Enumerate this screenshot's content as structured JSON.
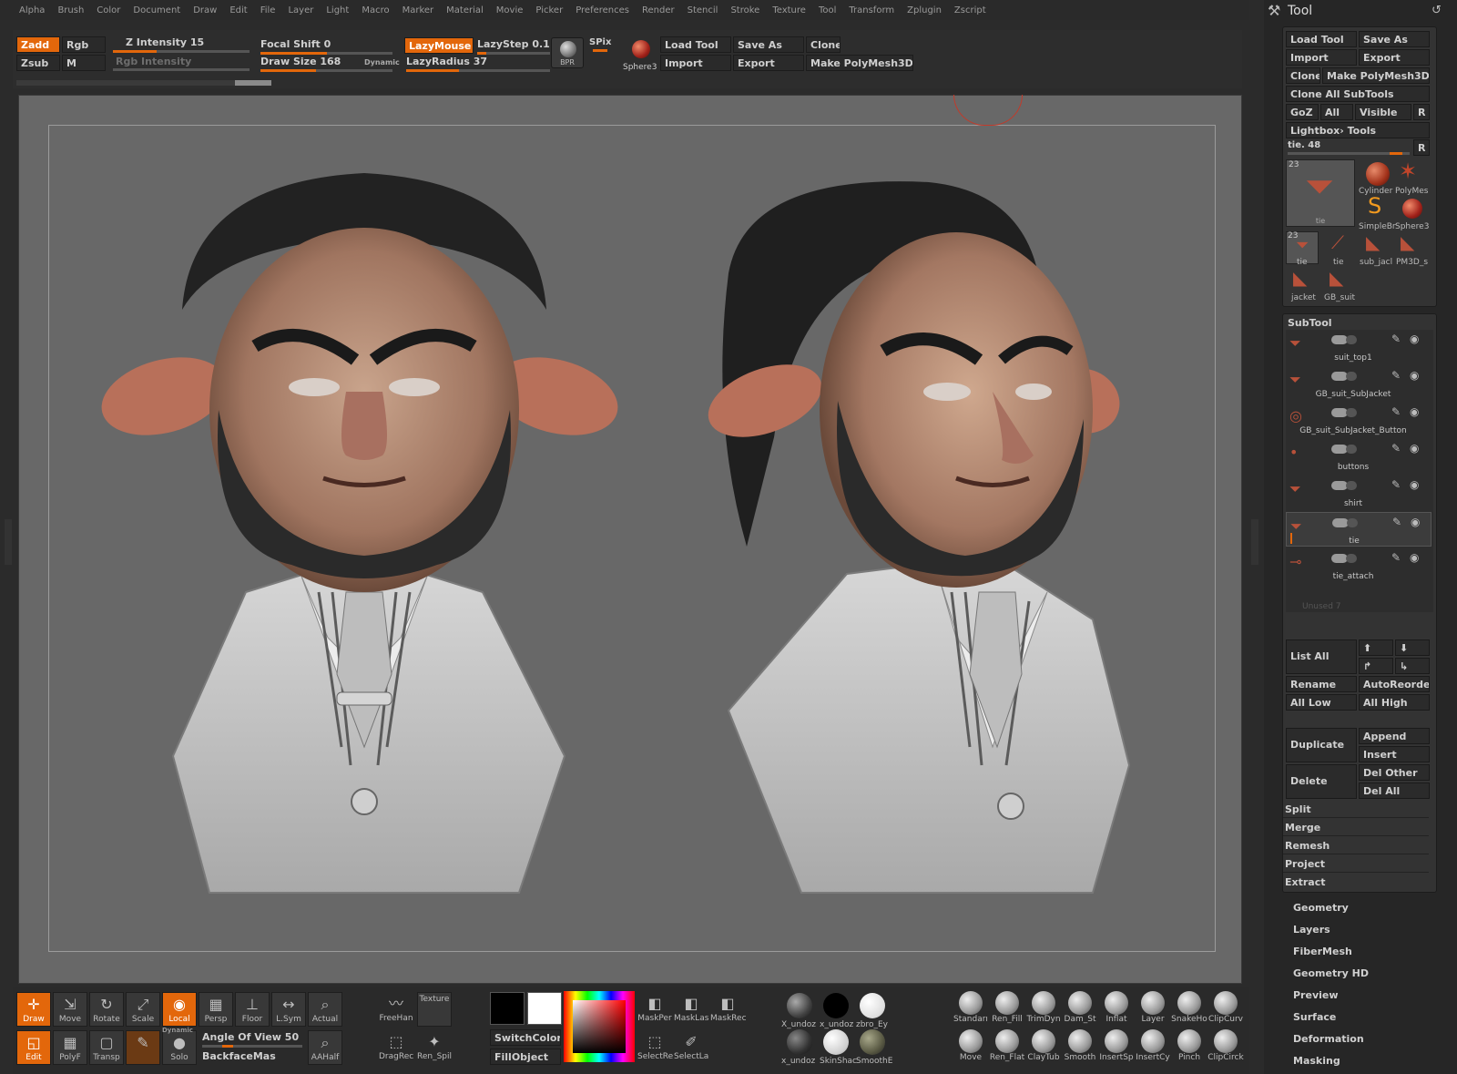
{
  "menubar": [
    "Alpha",
    "Brush",
    "Color",
    "Document",
    "Draw",
    "Edit",
    "File",
    "Layer",
    "Light",
    "Macro",
    "Marker",
    "Material",
    "Movie",
    "Picker",
    "Preferences",
    "Render",
    "Stencil",
    "Stroke",
    "Texture",
    "Tool",
    "Transform",
    "Zplugin",
    "Zscript"
  ],
  "topshelf": {
    "zadd": "Zadd",
    "zsub": "Zsub",
    "rgb": "Rgb",
    "m": "M",
    "z_intensity": "Z Intensity 15",
    "rgb_intensity": "Rgb Intensity",
    "focal_shift": "Focal Shift 0",
    "draw_size": "Draw Size 168",
    "dynamic": "Dynamic",
    "lazymouse": "LazyMouse",
    "lazystep": "LazyStep 0.1",
    "lazyradius": "LazyRadius 37",
    "spix": "SPix",
    "bpr": "BPR",
    "sphere3": "Sphere3",
    "load_tool": "Load Tool",
    "save_as": "Save As",
    "clone": "Clone",
    "import": "Import",
    "export": "Export",
    "make_polymesh": "Make PolyMesh3D",
    "z_intensity_value": 0.32,
    "focal_shift_value": 0.5,
    "draw_size_value": 0.42,
    "lazystep_value": 0.12,
    "lazyradius_value": 0.37
  },
  "bottomshelf": {
    "draw": "Draw",
    "move": "Move",
    "rotate": "Rotate",
    "scale": "Scale",
    "local": "Local",
    "persp": "Persp",
    "floor": "Floor",
    "lsym": "L.Sym",
    "actual": "Actual",
    "edit": "Edit",
    "polyf": "PolyF",
    "transp": "Transp",
    "dynamic": "Dynamic",
    "solo": "Solo",
    "aahalf": "AAHalf",
    "angle_of_view": "Angle Of View 50",
    "backfacemask": "BackfaceMas",
    "freehand": "FreeHan",
    "texture": "Texture",
    "dragrect": "DragRec",
    "renspi": "Ren_Spil",
    "switchcolor": "SwitchColor",
    "fillobject": "FillObject",
    "maskper": "MaskPer",
    "masklas": "MaskLas",
    "maskrec": "MaskRec",
    "selectre": "SelectRe",
    "selectla": "SelectLa",
    "mat1": "X_undoz",
    "mat2": "x_undoz",
    "mat3": "zbro_Ey",
    "mat4": "x_undoz",
    "mat5": "SkinShac",
    "mat6": "SmoothE",
    "brushes_top": [
      "Standarı",
      "Ren_Fill",
      "TrimDyn",
      "Dam_St",
      "Inflat",
      "Layer",
      "SnakeHo",
      "ClipCurv"
    ],
    "brushes_bottom": [
      "Move",
      "Ren_Flat",
      "ClayTub",
      "Smooth",
      "InsertSp",
      "InsertCy",
      "Pinch",
      "ClipCirck"
    ]
  },
  "tool": {
    "title": "Tool",
    "load_tool": "Load Tool",
    "save_as": "Save As",
    "import": "Import",
    "export": "Export",
    "clone": "Clone",
    "make_polymesh": "Make PolyMesh3D",
    "clone_all": "Clone All SubTools",
    "goz": "GoZ",
    "all": "All",
    "visible": "Visible",
    "r": "R",
    "lightbox": "Lightbox› Tools",
    "current": "tie. 48",
    "thumbs_top": [
      "Cylinder",
      "PolyMes",
      "SimpleBr",
      "Sphere3"
    ],
    "thumbs_count": "23",
    "thumb_main": "tie",
    "thumbs_row2": [
      "tie",
      "tie",
      "sub_jacl",
      "PM3D_s"
    ],
    "thumbs_row3": [
      "jacket",
      "GB_suit"
    ]
  },
  "subtool": {
    "title": "SubTool",
    "items": [
      "suit_top1",
      "GB_suit_SubJacket",
      "GB_suit_SubJacket_Button",
      "buttons",
      "shirt",
      "tie",
      "tie_attach"
    ],
    "unused": "Unused 7",
    "list_all": "List All",
    "rename": "Rename",
    "autoreorder": "AutoReorder",
    "all_low": "All Low",
    "all_high": "All High",
    "duplicate": "Duplicate",
    "append": "Append",
    "insert": "Insert",
    "delete": "Delete",
    "del_other": "Del Other",
    "del_all": "Del All",
    "split": "Split",
    "merge": "Merge",
    "remesh": "Remesh",
    "project": "Project",
    "extract": "Extract"
  },
  "sections": [
    "Geometry",
    "Layers",
    "FiberMesh",
    "Geometry HD",
    "Preview",
    "Surface",
    "Deformation",
    "Masking"
  ]
}
